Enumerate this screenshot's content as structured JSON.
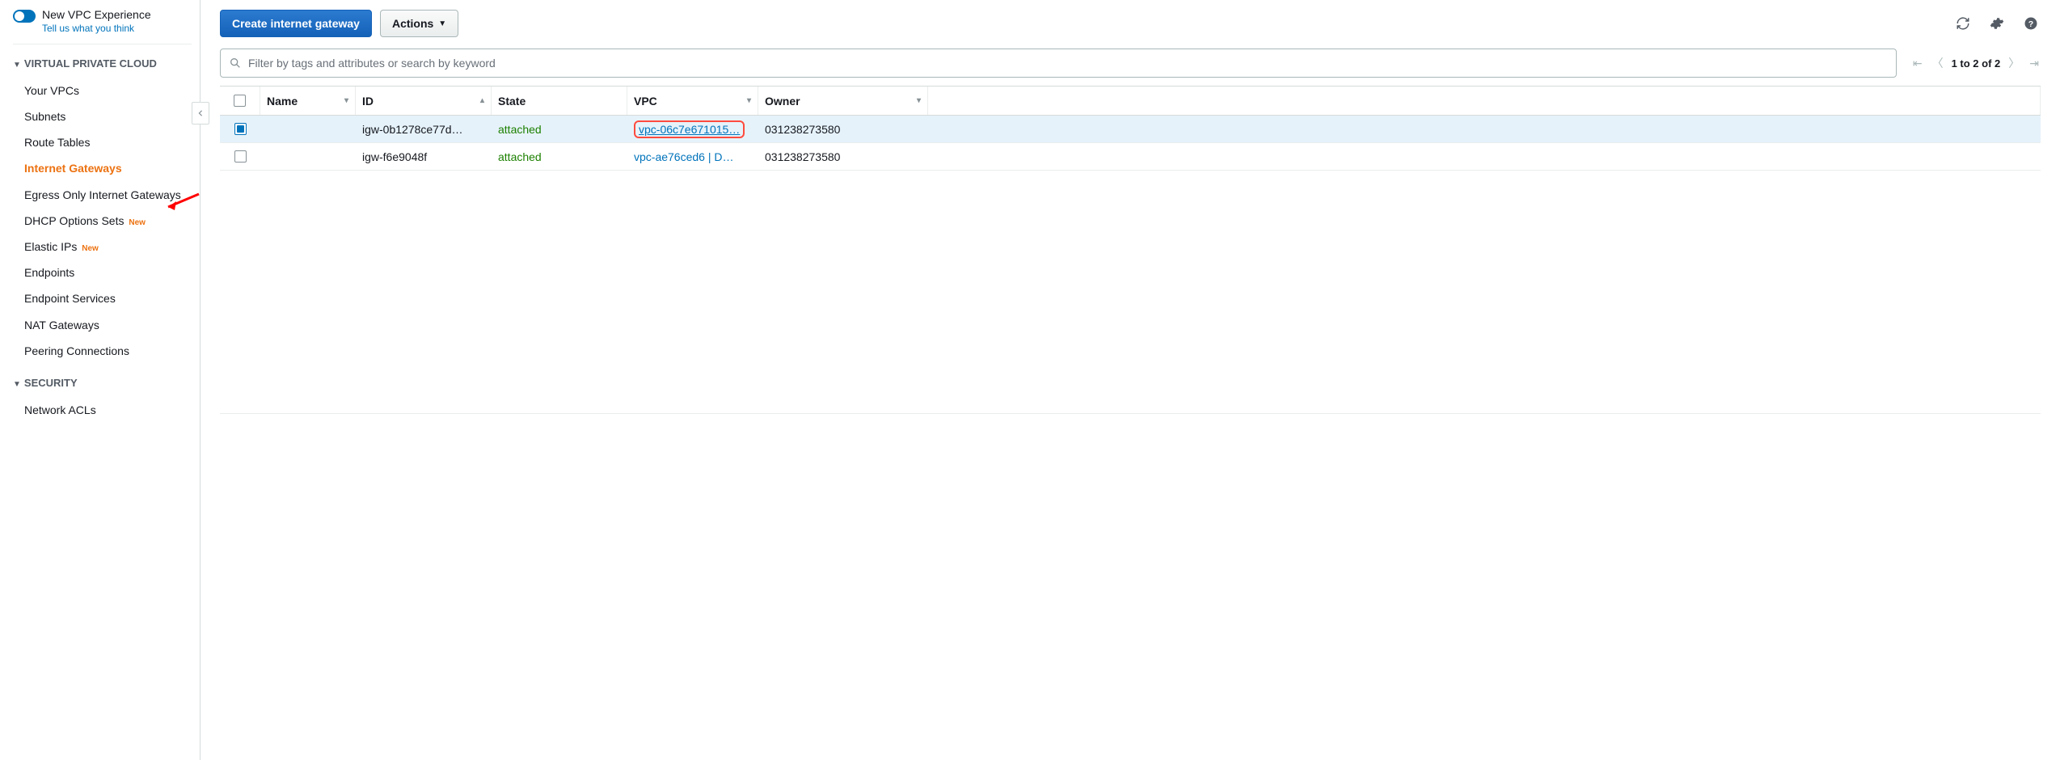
{
  "sidebar": {
    "new_experience_label": "New VPC Experience",
    "feedback_link": "Tell us what you think",
    "sections": [
      {
        "title": "VIRTUAL PRIVATE CLOUD",
        "items": [
          {
            "label": "Your VPCs",
            "active": false,
            "new": false
          },
          {
            "label": "Subnets",
            "active": false,
            "new": false
          },
          {
            "label": "Route Tables",
            "active": false,
            "new": false
          },
          {
            "label": "Internet Gateways",
            "active": true,
            "new": false
          },
          {
            "label": "Egress Only Internet Gateways",
            "active": false,
            "new": false
          },
          {
            "label": "DHCP Options Sets",
            "active": false,
            "new": true
          },
          {
            "label": "Elastic IPs",
            "active": false,
            "new": true
          },
          {
            "label": "Endpoints",
            "active": false,
            "new": false
          },
          {
            "label": "Endpoint Services",
            "active": false,
            "new": false
          },
          {
            "label": "NAT Gateways",
            "active": false,
            "new": false
          },
          {
            "label": "Peering Connections",
            "active": false,
            "new": false
          }
        ]
      },
      {
        "title": "SECURITY",
        "items": [
          {
            "label": "Network ACLs",
            "active": false,
            "new": false
          }
        ]
      }
    ]
  },
  "toolbar": {
    "create_label": "Create internet gateway",
    "actions_label": "Actions"
  },
  "search": {
    "placeholder": "Filter by tags and attributes or search by keyword"
  },
  "pagination": {
    "text": "1 to 2 of 2"
  },
  "new_badge_text": "New",
  "table": {
    "headers": [
      "Name",
      "ID",
      "State",
      "VPC",
      "Owner"
    ],
    "rows": [
      {
        "selected": true,
        "name": "",
        "id": "igw-0b1278ce77d…",
        "state": "attached",
        "vpc": "vpc-06c7e671015…",
        "vpc_highlight": true,
        "owner": "031238273580"
      },
      {
        "selected": false,
        "name": "",
        "id": "igw-f6e9048f",
        "state": "attached",
        "vpc": "vpc-ae76ced6 | D…",
        "vpc_highlight": false,
        "owner": "031238273580"
      }
    ]
  }
}
